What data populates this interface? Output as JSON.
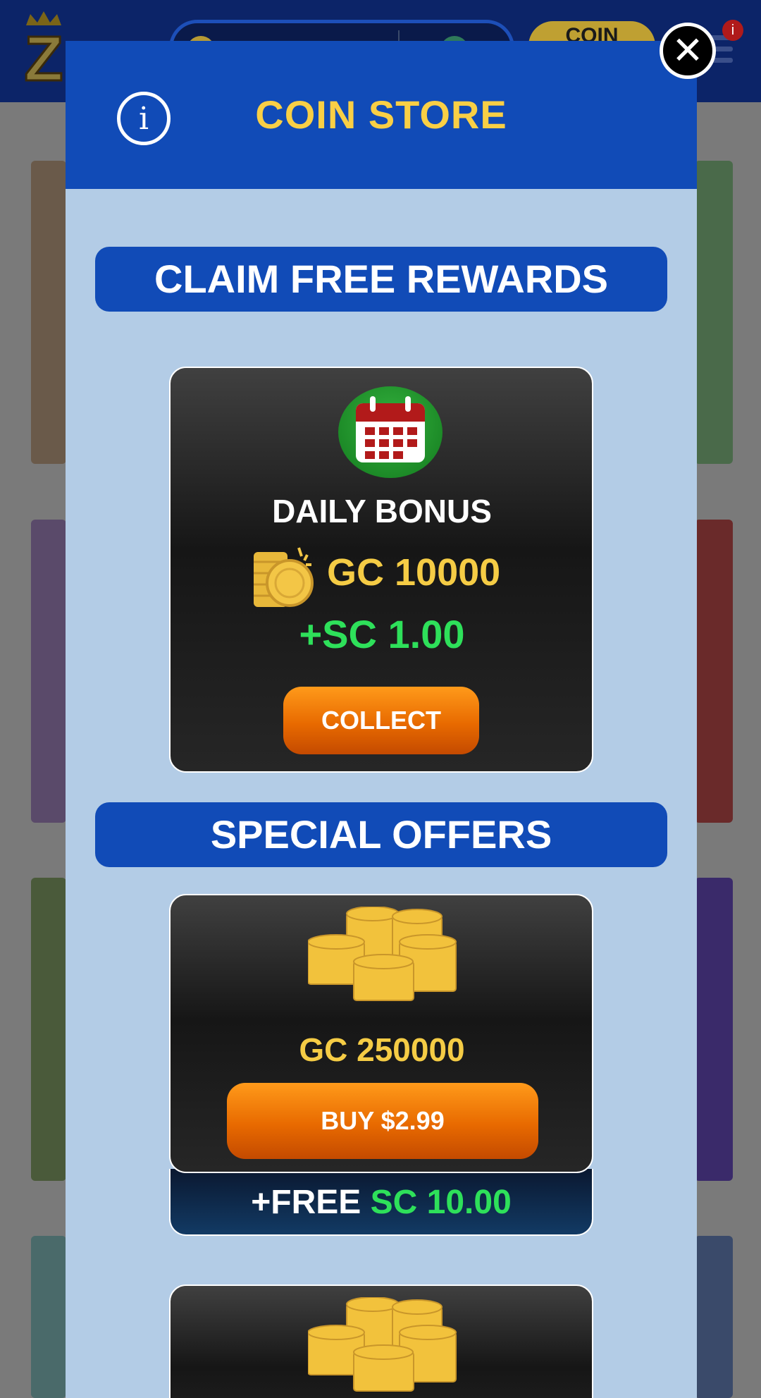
{
  "background": {
    "logo_letter": "Z",
    "coin_button_label": "COIN",
    "notification_count": "i"
  },
  "modal": {
    "title": "COIN STORE",
    "info_icon": "info-icon",
    "close_icon": "close-icon",
    "sections": {
      "free_rewards": "CLAIM FREE REWARDS",
      "special_offers": "SPECIAL OFFERS"
    },
    "daily_bonus": {
      "title": "DAILY BONUS",
      "gc_amount": "GC 10000",
      "sc_amount": "+SC 1.00",
      "button_label": "COLLECT",
      "icon": "calendar-icon"
    },
    "offers": [
      {
        "gc_amount": "GC 250000",
        "button_label": "BUY $2.99",
        "bonus_prefix": "+FREE",
        "bonus_sc": "SC 10.00",
        "icon": "coin-stack-icon"
      },
      {
        "icon": "coin-stack-icon"
      }
    ]
  },
  "colors": {
    "modal_bg": "#b3cce6",
    "header_blue": "#114bb7",
    "gold": "#f5cc45",
    "green": "#2ee05a",
    "orange": "#e86a00"
  }
}
